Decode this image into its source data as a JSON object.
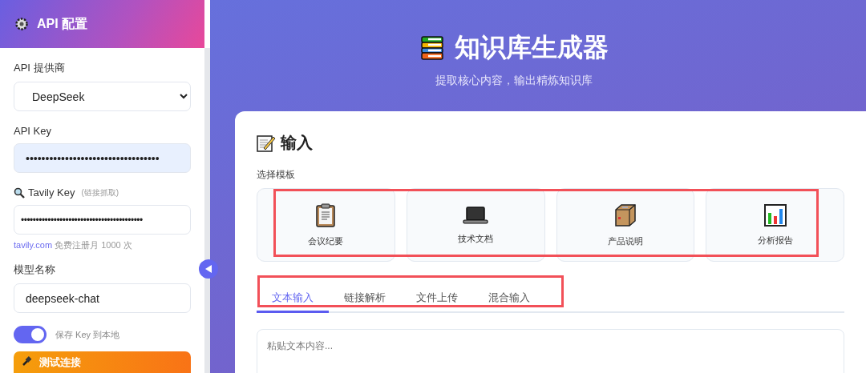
{
  "sidebar": {
    "title": "API 配置",
    "provider": {
      "label": "API 提供商",
      "value": "DeepSeek"
    },
    "api_key": {
      "label": "API Key",
      "value": "••••••••••••••••••••••••••••••••••"
    },
    "tavily_key": {
      "label": "Tavily Key",
      "note": "(链接抓取)",
      "value": "•••••••••••••••••••••••••••••••••••••••••"
    },
    "tavily_hint": {
      "link": "tavily.com",
      "text": "免费注册月 1000 次"
    },
    "model": {
      "label": "模型名称",
      "value": "deepseek-chat"
    },
    "save_toggle": {
      "label": "保存 Key 到本地",
      "on": true
    },
    "test_button": "测试连接"
  },
  "header": {
    "title": "知识库生成器",
    "subtitle": "提取核心内容，输出精炼知识库"
  },
  "input_panel": {
    "title": "输入",
    "template_label": "选择模板",
    "templates": [
      {
        "kind": "clipboard",
        "label": "会议纪要",
        "selected": false
      },
      {
        "kind": "laptop",
        "label": "技术文档",
        "selected": false
      },
      {
        "kind": "box",
        "label": "产品说明",
        "selected": false
      },
      {
        "kind": "chart",
        "label": "分析报告",
        "selected": false
      }
    ],
    "tabs": [
      {
        "label": "文本输入",
        "selected": true
      },
      {
        "label": "链接解析",
        "selected": false
      },
      {
        "label": "文件上传",
        "selected": false
      },
      {
        "label": "混合输入",
        "selected": false
      }
    ],
    "text_area": {
      "placeholder": "粘贴文本内容..."
    }
  }
}
